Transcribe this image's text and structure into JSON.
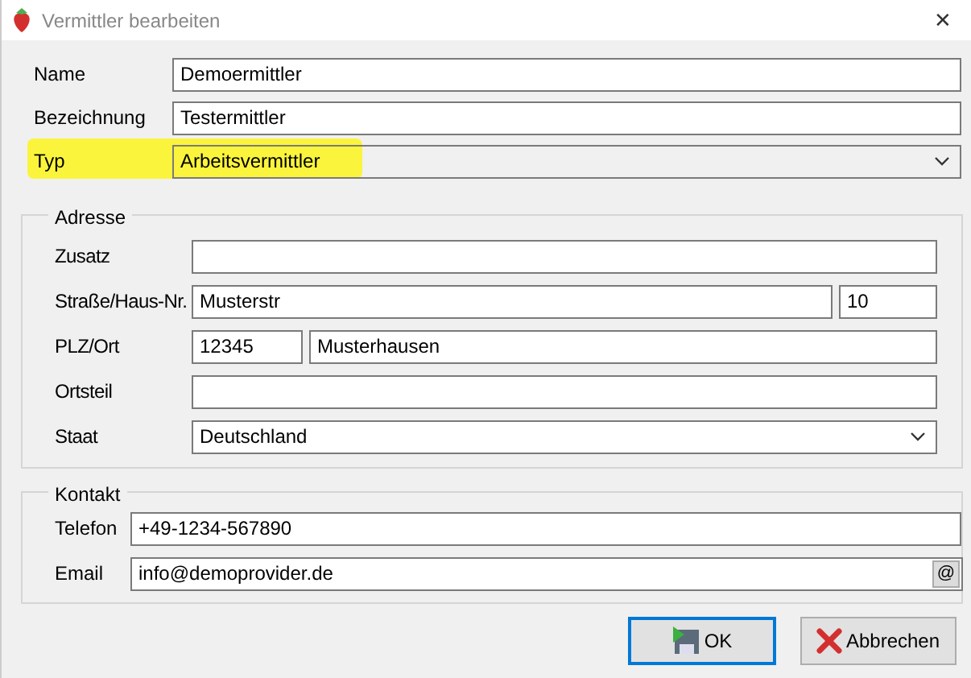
{
  "window": {
    "title": "Vermittler bearbeiten",
    "close": "✕"
  },
  "fields": [
    {
      "label": "Name",
      "value": "Demoermittler",
      "kind": "text",
      "highlighted": false
    },
    {
      "label": "Bezeichnung",
      "value": "Testermittler",
      "kind": "text",
      "highlighted": false
    },
    {
      "label": "Typ",
      "value": "Arbeitsvermittler",
      "kind": "select",
      "highlighted": true
    }
  ],
  "address": {
    "title": "Adresse",
    "rows": [
      {
        "label": "Zusatz",
        "kind": "single",
        "values": []
      },
      {
        "label": "Straße/Haus-Nr.",
        "kind": "street",
        "values": [
          "Musterstr",
          "10"
        ]
      },
      {
        "label": "PLZ/Ort",
        "kind": "zip",
        "values": [
          "12345",
          "Musterhausen"
        ]
      },
      {
        "label": "Ortsteil",
        "kind": "single",
        "values": []
      },
      {
        "label": "Staat",
        "kind": "select",
        "values": [
          "Deutschland"
        ]
      }
    ]
  },
  "contact": {
    "title": "Kontakt",
    "rows": [
      {
        "label": "Telefon",
        "value": "+49-1234-567890",
        "kind": "text"
      },
      {
        "label": "Email",
        "value": "info@demoprovider.de",
        "kind": "email",
        "button": "@"
      }
    ]
  },
  "buttons": [
    {
      "label": "OK",
      "kind": "ok",
      "selected": true
    },
    {
      "label": "Abbrechen",
      "kind": "cancel",
      "selected": false
    }
  ]
}
